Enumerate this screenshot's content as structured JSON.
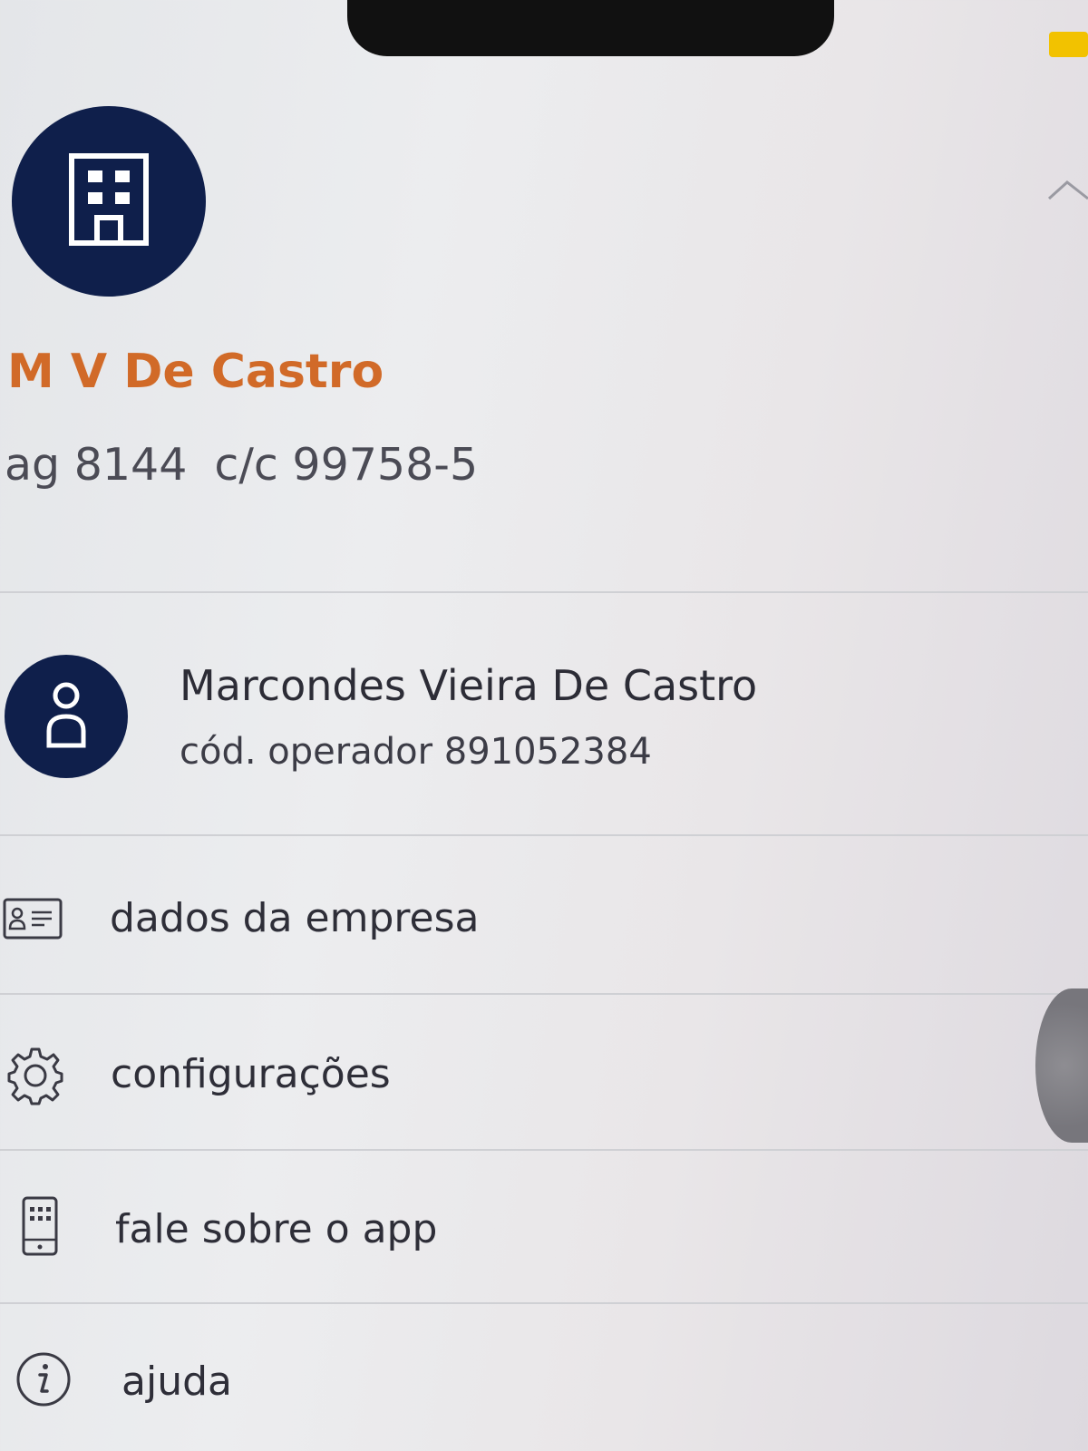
{
  "header": {
    "company_name": "M V De Castro",
    "agency_label": "ag 8144",
    "account_label": "c/c 99758-5"
  },
  "icons": {
    "company": "building-icon",
    "collapse": "chevron-up-icon",
    "user": "person-icon",
    "company_data": "id-card-icon",
    "settings": "gear-icon",
    "feedback": "phone-app-icon",
    "help": "info-icon"
  },
  "operator": {
    "name": "Marcondes Vieira De Castro",
    "code": "cód. operador 891052384"
  },
  "menu": {
    "items": [
      {
        "label": "dados da empresa"
      },
      {
        "label": "configurações"
      },
      {
        "label": "fale sobre o app"
      },
      {
        "label": "ajuda"
      }
    ]
  },
  "colors": {
    "accent": "#d16a28",
    "navy": "#0f1f4b"
  }
}
